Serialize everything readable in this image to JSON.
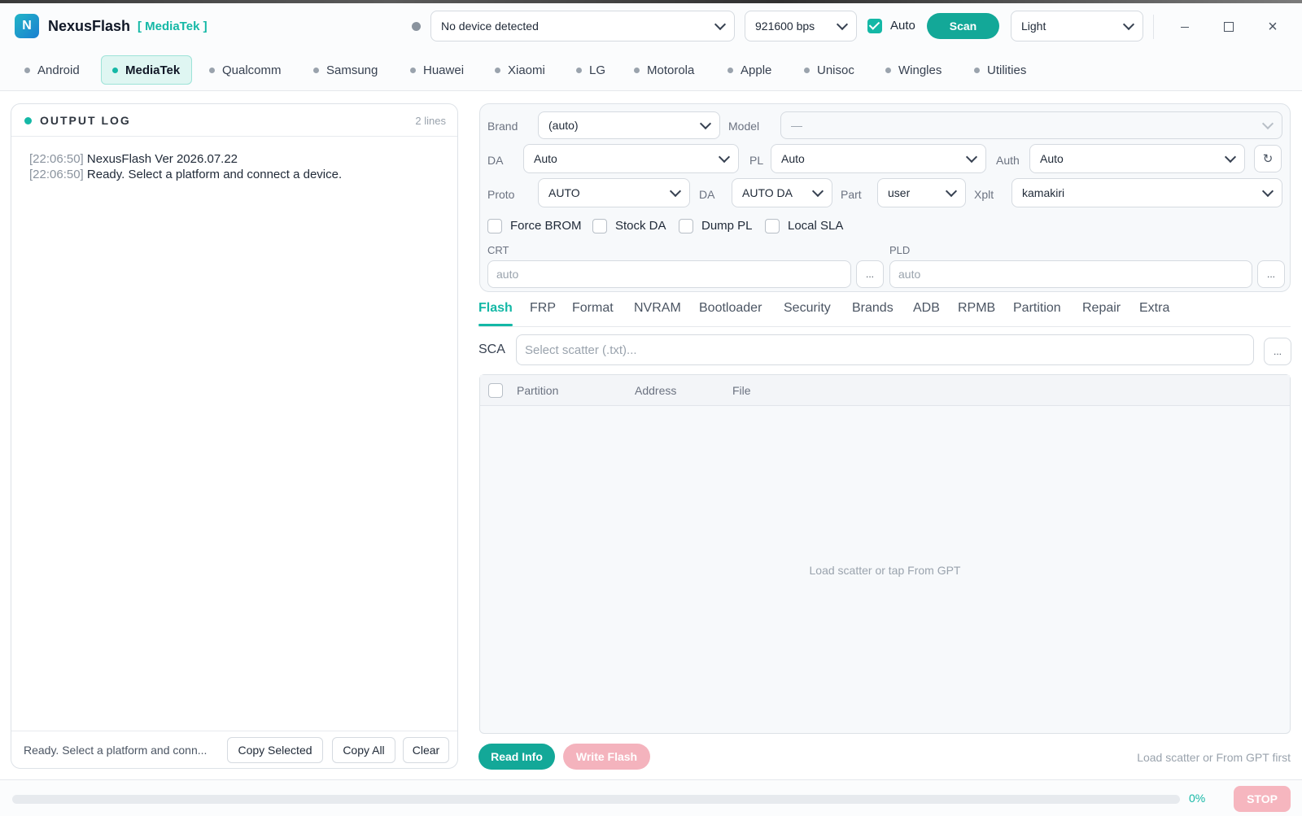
{
  "app": {
    "logo_letter": "N",
    "name": "NexusFlash",
    "platform_tag": "[ MediaTek ]"
  },
  "header": {
    "device_select": "No device detected",
    "baud_select": "921600 bps",
    "auto_checked": true,
    "auto_label": "Auto",
    "scan_label": "Scan",
    "theme_select": "Light",
    "close_glyph": "×"
  },
  "platform_tabs": [
    {
      "label": "Android",
      "active": false
    },
    {
      "label": "MediaTek",
      "active": true
    },
    {
      "label": "Qualcomm",
      "active": false
    },
    {
      "label": "Samsung",
      "active": false
    },
    {
      "label": "Huawei",
      "active": false
    },
    {
      "label": "Xiaomi",
      "active": false
    },
    {
      "label": "LG",
      "active": false
    },
    {
      "label": "Motorola",
      "active": false
    },
    {
      "label": "Apple",
      "active": false
    },
    {
      "label": "Unisoc",
      "active": false
    },
    {
      "label": "Wingles",
      "active": false
    },
    {
      "label": "Utilities",
      "active": false
    }
  ],
  "log": {
    "title": "OUTPUT LOG",
    "count": "2 lines",
    "lines": [
      {
        "ts": "[22:06:50]",
        "text": " NexusFlash Ver 2026.07.22"
      },
      {
        "ts": "[22:06:50]",
        "text": " Ready. Select a platform and connect a device."
      }
    ],
    "status": "Ready. Select a platform and conn...",
    "copy_selected": "Copy Selected",
    "copy_all": "Copy All",
    "clear": "Clear"
  },
  "config": {
    "brand_label": "Brand",
    "brand_value": "(auto)",
    "model_label": "Model",
    "model_value": "—",
    "da_label": "DA",
    "da_value": "Auto",
    "pl_label": "PL",
    "pl_value": "Auto",
    "auth_label": "Auth",
    "auth_value": "Auto",
    "proto_label": "Proto",
    "proto_value": "AUTO",
    "da2_label": "DA",
    "da2_value": "AUTO DA",
    "part_label": "Part",
    "part_value": "user",
    "xplt_label": "Xplt",
    "xplt_value": "kamakiri",
    "checkboxes": [
      {
        "label": "Force BROM",
        "checked": false
      },
      {
        "label": "Stock DA",
        "checked": false
      },
      {
        "label": "Dump PL",
        "checked": false
      },
      {
        "label": "Local SLA",
        "checked": false
      }
    ],
    "crt_label": "CRT",
    "crt_placeholder": "auto",
    "pld_label": "PLD",
    "pld_placeholder": "auto",
    "browse_glyph": "..."
  },
  "function_tabs": [
    "Flash",
    "FRP",
    "Format",
    "NVRAM",
    "Bootloader",
    "Security",
    "Brands",
    "ADB",
    "RPMB",
    "Partition",
    "Repair",
    "Extra"
  ],
  "active_function_tab": "Flash",
  "scatter": {
    "label": "SCA",
    "placeholder": "Select scatter (.txt)...",
    "browse_glyph": "..."
  },
  "partition_table": {
    "columns": [
      "Partition",
      "Address",
      "File"
    ],
    "rows": [],
    "empty_message": "Load scatter or tap From GPT"
  },
  "actions": {
    "read_info": "Read Info",
    "write_flash": "Write Flash",
    "hint": "Load scatter or From GPT first"
  },
  "progress": {
    "value": 0,
    "label": "0%",
    "stop": "STOP"
  },
  "colors": {
    "accent": "#14b8a6",
    "stop_disabled": "#f6b6bf",
    "write_disabled": "#f4b3bd"
  }
}
